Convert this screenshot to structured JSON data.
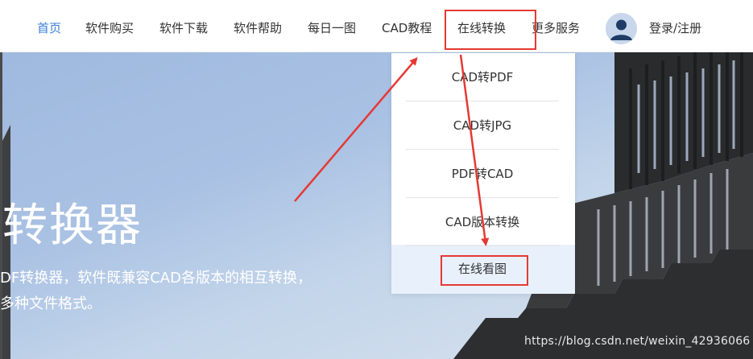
{
  "nav": {
    "items": [
      {
        "label": "首页",
        "active": true
      },
      {
        "label": "软件购买"
      },
      {
        "label": "软件下载"
      },
      {
        "label": "软件帮助"
      },
      {
        "label": "每日一图"
      },
      {
        "label": "CAD教程"
      },
      {
        "label": "在线转换"
      },
      {
        "label": "更多服务"
      }
    ],
    "login": "登录/注册"
  },
  "hero": {
    "title": "转换器",
    "desc_line1": "DF转换器，软件既兼容CAD各版本的相互转换，",
    "desc_line2": "多种文件格式。"
  },
  "dropdown": {
    "items": [
      "CAD转PDF",
      "CAD转JPG",
      "PDF转CAD",
      "CAD版本转换",
      "在线看图"
    ]
  },
  "watermark": "https://blog.csdn.net/weixin_42936066",
  "colors": {
    "accent": "#3b7fd8",
    "annotation": "#e53935",
    "highlight": "#e8f0fb"
  }
}
